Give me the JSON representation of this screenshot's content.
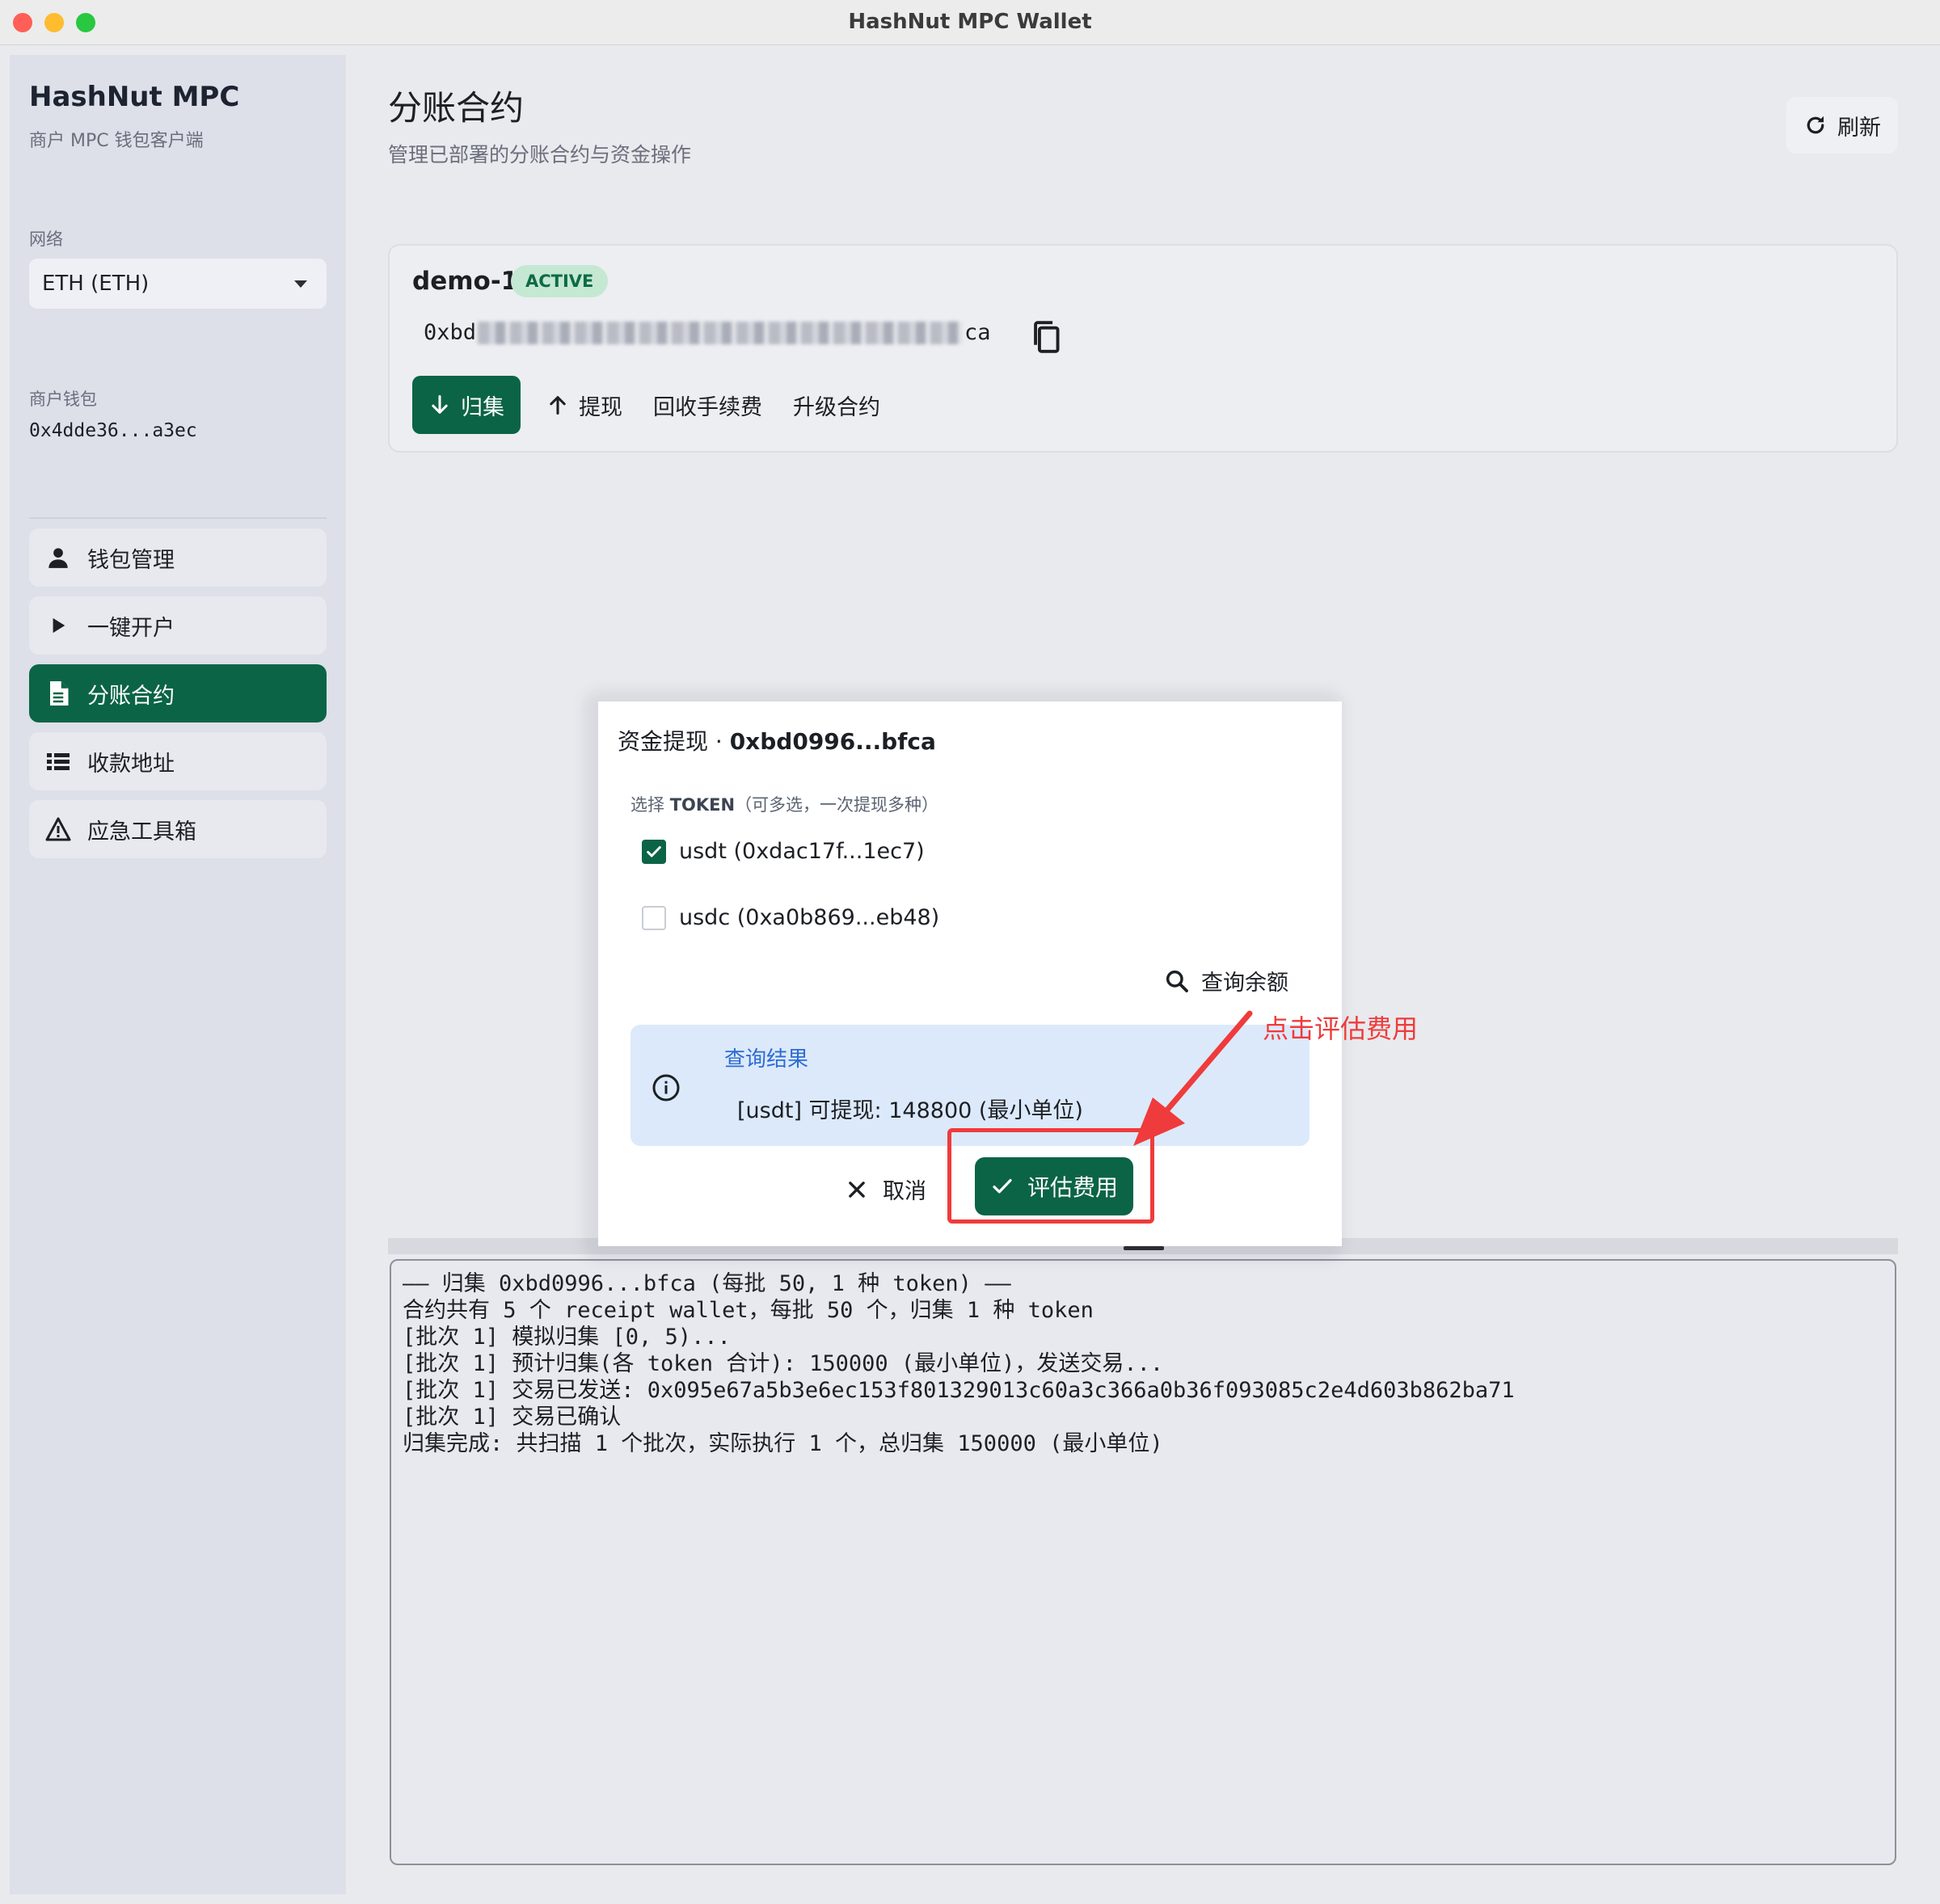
{
  "window": {
    "title": "HashNut MPC Wallet"
  },
  "sidebar": {
    "app_name": "HashNut MPC",
    "app_subtitle": "商户 MPC 钱包客户端",
    "network_label": "网络",
    "network_value": "ETH (ETH)",
    "wallet_label": "商户钱包",
    "wallet_address": "0x4dde36...a3ec",
    "nav": [
      {
        "label": "钱包管理",
        "icon": "person-icon",
        "active": false
      },
      {
        "label": "一键开户",
        "icon": "play-icon",
        "active": false
      },
      {
        "label": "分账合约",
        "icon": "document-icon",
        "active": true
      },
      {
        "label": "收款地址",
        "icon": "list-icon",
        "active": false
      },
      {
        "label": "应急工具箱",
        "icon": "warning-icon",
        "active": false
      }
    ]
  },
  "header": {
    "title": "分账合约",
    "subtitle": "管理已部署的分账合约与资金操作",
    "refresh_label": "刷新"
  },
  "contract": {
    "name": "demo-1",
    "status": "ACTIVE",
    "address_prefix": "0xbd",
    "address_suffix": "ca",
    "actions": {
      "collect": "归集",
      "withdraw": "提现",
      "reclaim_fee": "回收手续费",
      "upgrade": "升级合约"
    }
  },
  "modal": {
    "title_prefix": "资金提现 · ",
    "title_address": "0xbd0996...bfca",
    "token_label_prefix": "选择 ",
    "token_label_bold": "TOKEN",
    "token_label_suffix": "（可多选，一次提现多种）",
    "tokens": [
      {
        "label": "usdt (0xdac17f...1ec7)",
        "checked": true
      },
      {
        "label": "usdc (0xa0b869...eb48)",
        "checked": false
      }
    ],
    "query_label": "查询余额",
    "result_title": "查询结果",
    "result_text": "[usdt] 可提现: 148800 (最小单位)",
    "cancel_label": "取消",
    "confirm_label": "评估费用"
  },
  "annotation": {
    "text": "点击评估费用",
    "color": "#ef3b3b"
  },
  "log": [
    "—— 归集 0xbd0996...bfca (每批 50, 1 种 token) ——",
    "合约共有 5 个 receipt wallet，每批 50 个，归集 1 种 token",
    "[批次 1] 模拟归集 [0, 5)...",
    "[批次 1] 预计归集(各 token 合计): 150000 (最小单位)，发送交易...",
    "[批次 1] 交易已发送: 0x095e67a5b3e6ec153f801329013c60a3c366a0b36f093085c2e4d603b862ba71",
    "[批次 1] 交易已确认",
    "归集完成: 共扫描 1 个批次，实际执行 1 个，总归集 150000 (最小单位)"
  ],
  "colors": {
    "accent": "#0b6445",
    "badge_bg": "#c5e8d3",
    "info_bg": "#dce9fb",
    "info_title": "#2d6cd2"
  }
}
